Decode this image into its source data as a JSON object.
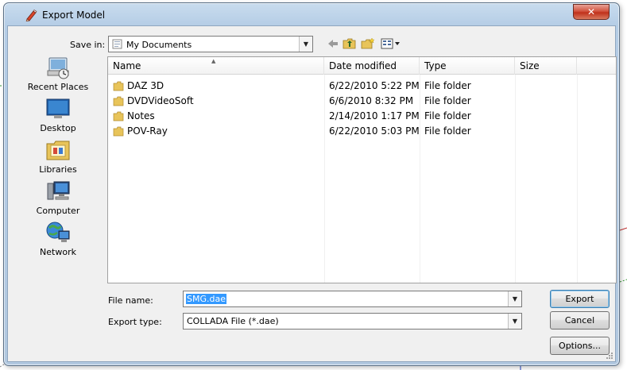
{
  "window": {
    "title": "Export Model",
    "close_glyph": "✕"
  },
  "toolbar": {
    "save_in_label": "Save in:",
    "save_in_value": "My Documents",
    "icons": [
      "back-arrow-icon",
      "up-folder-icon",
      "new-folder-icon",
      "view-menu-icon"
    ]
  },
  "places": [
    {
      "label": "Recent Places",
      "icon": "recent-places-icon"
    },
    {
      "label": "Desktop",
      "icon": "desktop-icon"
    },
    {
      "label": "Libraries",
      "icon": "libraries-icon"
    },
    {
      "label": "Computer",
      "icon": "computer-icon"
    },
    {
      "label": "Network",
      "icon": "network-icon"
    }
  ],
  "file_list": {
    "columns": [
      "Name",
      "Date modified",
      "Type",
      "Size"
    ],
    "rows": [
      {
        "name": "DAZ 3D",
        "date": "6/22/2010 5:22 PM",
        "type": "File folder",
        "size": ""
      },
      {
        "name": "DVDVideoSoft",
        "date": "6/6/2010 8:32 PM",
        "type": "File folder",
        "size": ""
      },
      {
        "name": "Notes",
        "date": "2/14/2010 1:17 PM",
        "type": "File folder",
        "size": ""
      },
      {
        "name": "POV-Ray",
        "date": "6/22/2010 5:03 PM",
        "type": "File folder",
        "size": ""
      }
    ]
  },
  "footer": {
    "file_name_label": "File name:",
    "file_name_value": "SMG.dae",
    "export_type_label": "Export type:",
    "export_type_value": "COLLADA File (*.dae)",
    "export_button": "Export",
    "cancel_button": "Cancel",
    "options_button": "Options..."
  },
  "colors": {
    "selection": "#3399ff",
    "close_button": "#c0301b",
    "folder": "#e8c45a"
  }
}
